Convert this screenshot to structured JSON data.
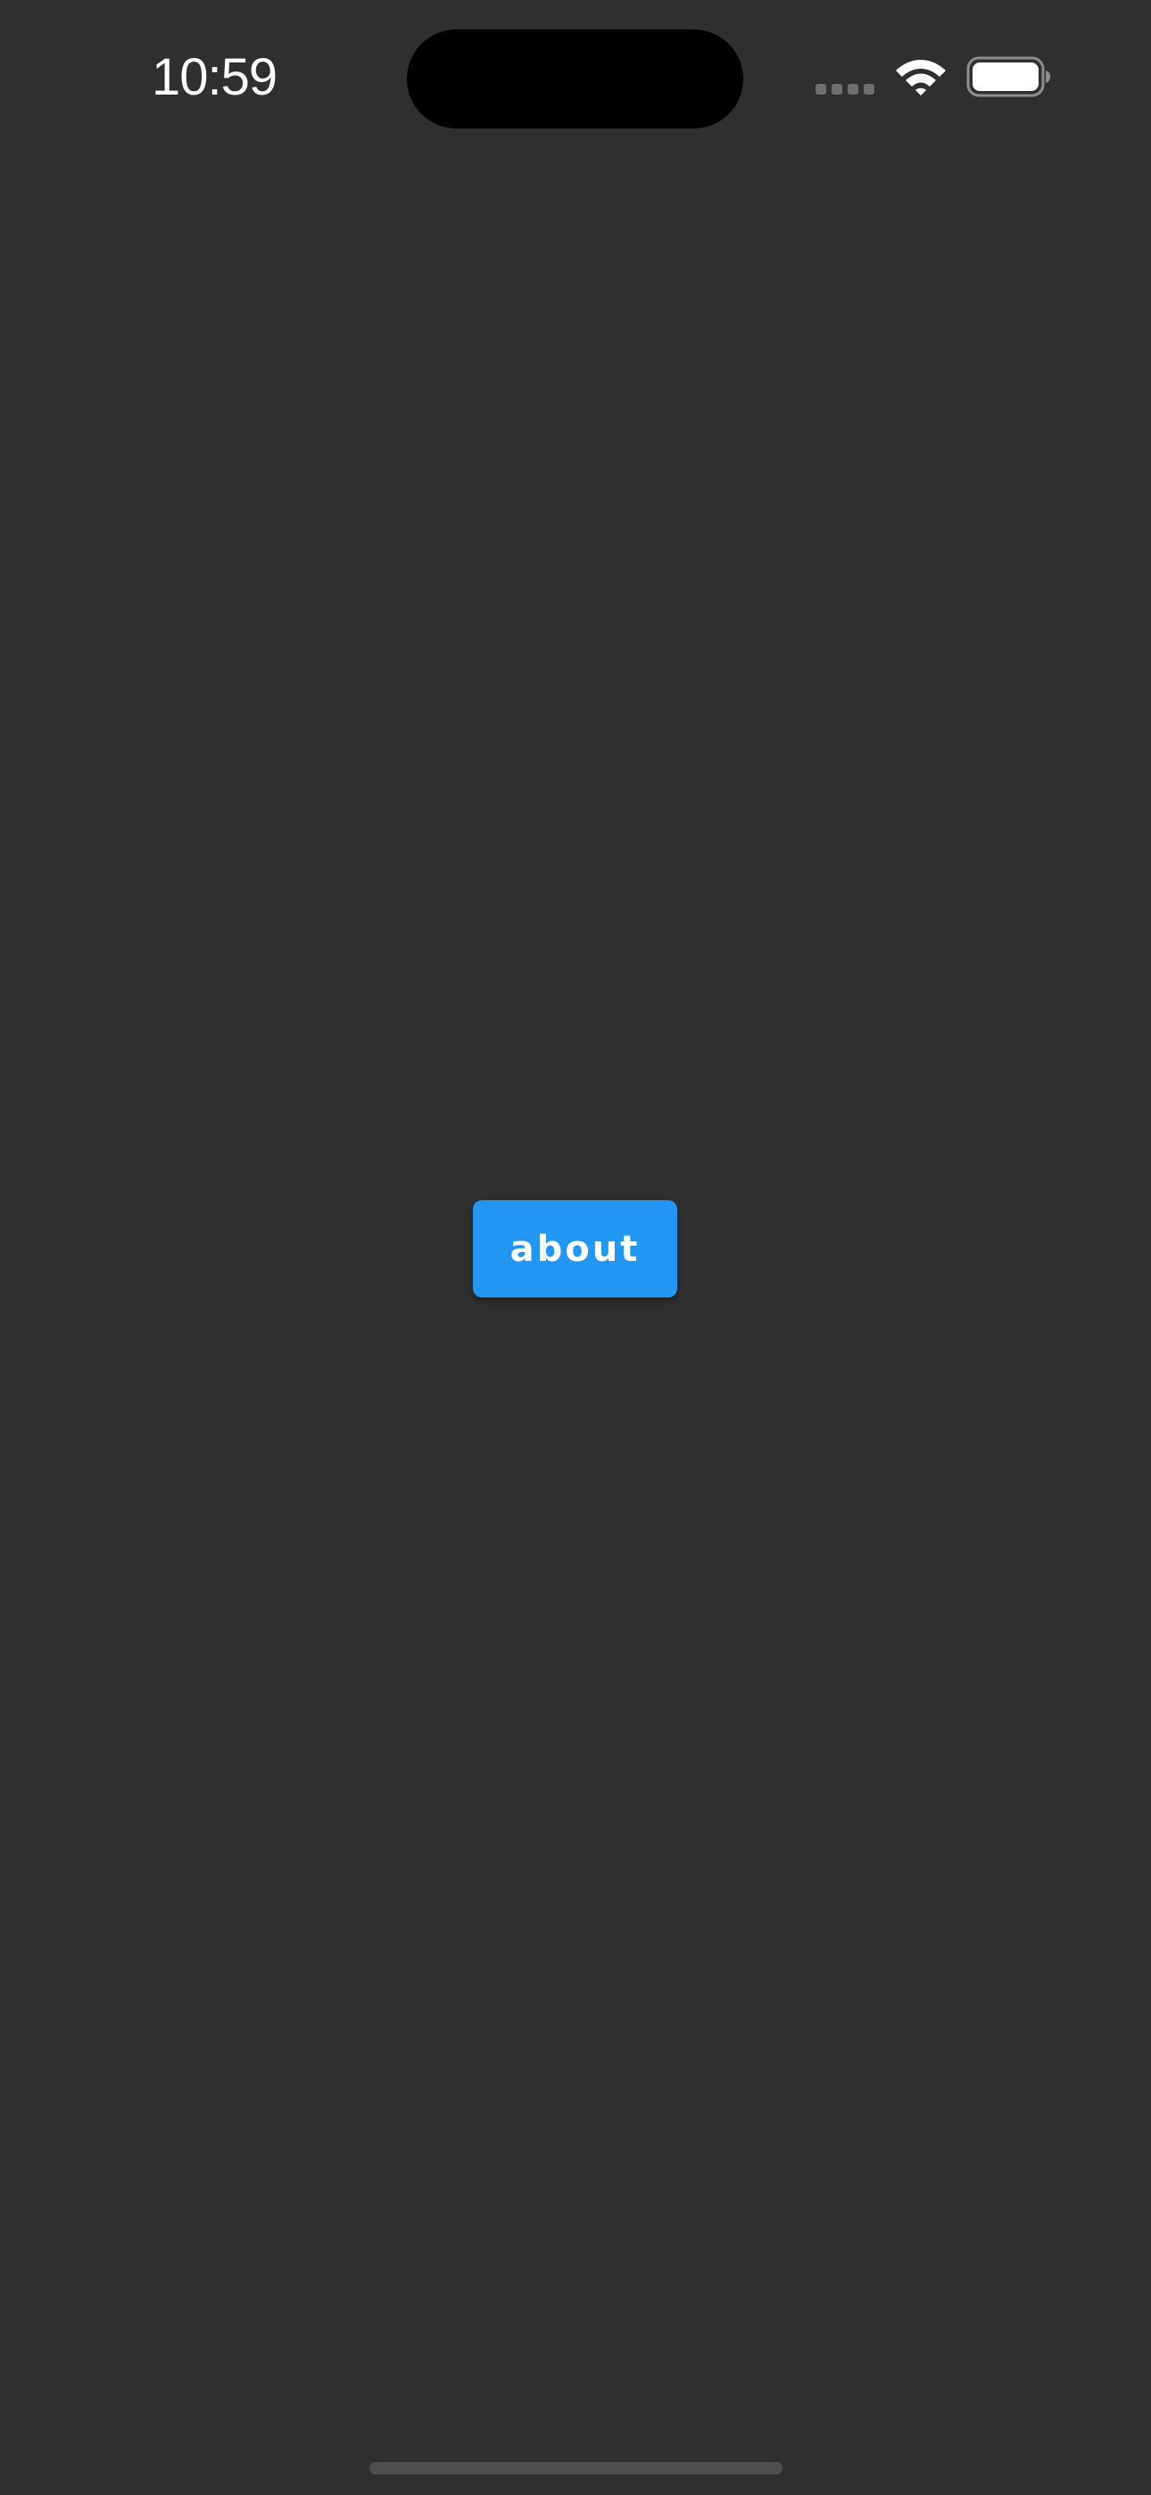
{
  "status_bar": {
    "time": "10:59",
    "icons": {
      "signal": "cellular-signal-icon",
      "wifi": "wifi-icon",
      "battery": "battery-icon"
    }
  },
  "main": {
    "about_button_label": "about"
  },
  "colors": {
    "background": "#2f2f2f",
    "button": "#2196f3",
    "button_text": "#ffffff",
    "status_text": "#ffffff"
  }
}
